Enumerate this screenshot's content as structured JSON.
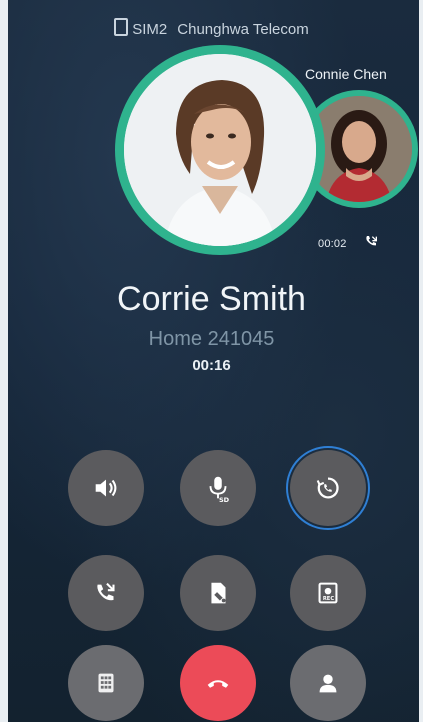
{
  "status_bar": {
    "sim_label": "SIM2",
    "carrier": "Chunghwa Telecom"
  },
  "secondary_call": {
    "name": "Connie Chen",
    "timer": "00:02"
  },
  "main_call": {
    "name": "Corrie Smith",
    "subtitle": "Home 241045",
    "timer": "00:16"
  },
  "controls": {
    "row1": [
      "speaker-icon",
      "mute-mic-icon",
      "swap-call-icon"
    ],
    "row2": [
      "add-call-icon",
      "note-icon",
      "record-icon"
    ],
    "row3": [
      "dialpad-icon",
      "end-call-icon",
      "contacts-icon"
    ]
  },
  "colors": {
    "accent_ring": "#2fb38e",
    "end_call": "#ec4b58",
    "focus_ring": "#2f7fd4"
  }
}
